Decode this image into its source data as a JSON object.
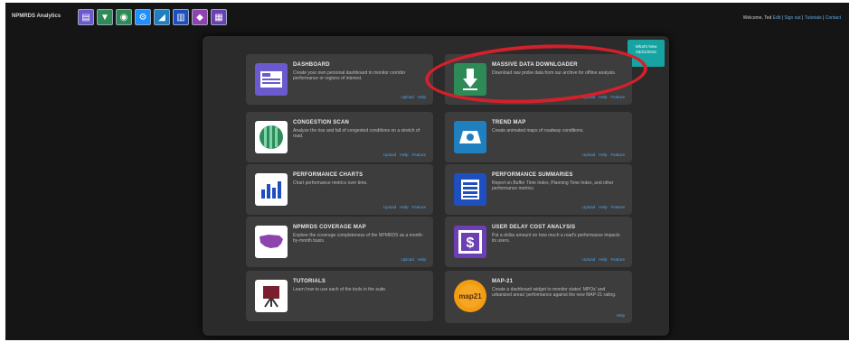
{
  "app": {
    "brand": "NPMRDS Analytics",
    "welcome_prefix": "Welcome, Ted",
    "welcome_links": [
      "Edit",
      "Sign out",
      "Tutorials",
      "Contact"
    ]
  },
  "toolbar": {
    "icons": [
      "dashboard-icon",
      "downloader-icon",
      "congestion-icon",
      "settings-icon",
      "trend-map-icon",
      "charts-icon",
      "coverage-icon",
      "user-delay-icon"
    ],
    "colors": [
      "#6a5acd",
      "#2e8b57",
      "#2e8b57",
      "#1e90ff",
      "#1f7fbf",
      "#1f4fbf",
      "#8e44ad",
      "#6c3fb5"
    ]
  },
  "whats_new": {
    "line1": "What's New",
    "line2": "03/31/2015"
  },
  "cards": [
    {
      "key": "dashboard",
      "title": "DASHBOARD",
      "desc": "Create your own personal dashboard to monitor corridor performance or regions of interest.",
      "links": [
        "Upload",
        "Help"
      ]
    },
    {
      "key": "massive-data-downloader",
      "title": "MASSIVE DATA DOWNLOADER",
      "desc": "Download raw probe data from our archive for offline analysis.",
      "links": [
        "Upload",
        "Help",
        "Feature"
      ]
    },
    {
      "key": "congestion-scan",
      "title": "CONGESTION SCAN",
      "desc": "Analyze the rise and fall of congested conditions on a stretch of road.",
      "links": [
        "Upload",
        "Help",
        "Feature"
      ]
    },
    {
      "key": "trend-map",
      "title": "TREND MAP",
      "desc": "Create animated maps of roadway conditions.",
      "links": [
        "Upload",
        "Help",
        "Feature"
      ]
    },
    {
      "key": "performance-charts",
      "title": "PERFORMANCE CHARTS",
      "desc": "Chart performance metrics over time.",
      "links": [
        "Upload",
        "Help",
        "Feature"
      ]
    },
    {
      "key": "performance-summaries",
      "title": "PERFORMANCE SUMMARIES",
      "desc": "Report on Buffer Time Index, Planning Time Index, and other performance metrics.",
      "links": [
        "Upload",
        "Help",
        "Feature"
      ]
    },
    {
      "key": "npmrds-coverage-map",
      "title": "NPMRDS COVERAGE MAP",
      "desc": "Explore the coverage completeness of the NPMRDS as a month-by-month basis.",
      "links": [
        "Upload",
        "Help"
      ]
    },
    {
      "key": "user-delay-cost-analysis",
      "title": "USER DELAY COST ANALYSIS",
      "desc": "Put a dollar amount on how much a road's performance impacts its users.",
      "links": [
        "Upload",
        "Help",
        "Feature"
      ]
    },
    {
      "key": "tutorials",
      "title": "TUTORIALS",
      "desc": "Learn how to use each of the tools in the suite.",
      "links": []
    },
    {
      "key": "map-21",
      "title": "MAP-21",
      "desc": "Create a dashboard widget to monitor states' MPOs' and urbanized areas' performance against the new MAP-21 rating.",
      "links": [
        "Help"
      ]
    }
  ],
  "highlight": {
    "card": "massive-data-downloader",
    "color": "#d4202a"
  }
}
